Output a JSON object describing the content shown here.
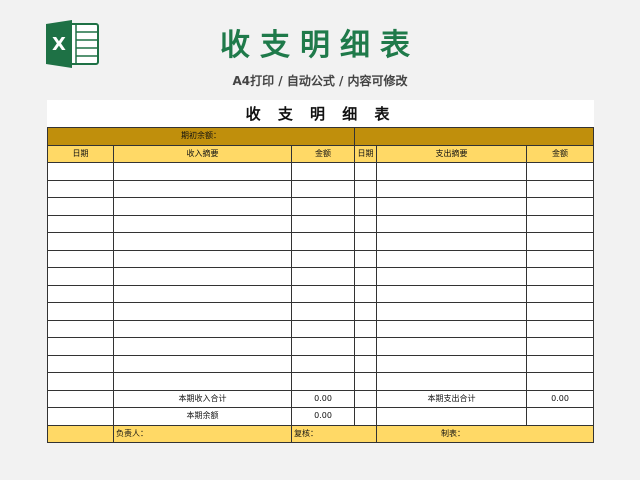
{
  "page": {
    "title": "收支明细表",
    "subtitle": "A4打印 / 自动公式 / 内容可修改",
    "logo": {
      "icon": "excel-icon",
      "letter": "X",
      "color": "#1e7145"
    }
  },
  "sheet": {
    "title": "收 支 明 细 表",
    "opening_balance_label": "期初余额：",
    "headers": {
      "income_date": "日期",
      "income_summary": "收入摘要",
      "income_amount": "金额",
      "expense_date": "日期",
      "expense_summary": "支出摘要",
      "expense_amount": "金额"
    },
    "totals": {
      "income_total_label": "本期收入合计",
      "income_total_value": "0.00",
      "expense_total_label": "本期支出合计",
      "expense_total_value": "0.00",
      "balance_label": "本期余额",
      "balance_value": "0.00"
    },
    "footer": {
      "responsible": "负责人：",
      "reviewer": "复核：",
      "preparer": "制表："
    },
    "colors": {
      "balance_row": "#c08f0c",
      "header_row": "#ffd966",
      "title_green": "#1f7a4a"
    }
  }
}
